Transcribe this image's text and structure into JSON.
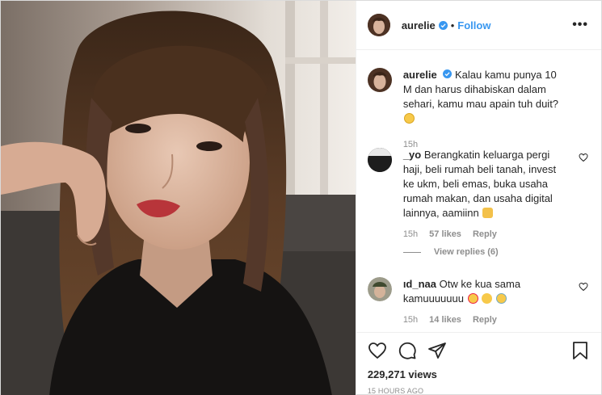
{
  "post": {
    "author": "aurelie",
    "follow_label": "Follow",
    "dot": "•",
    "more_label": "•••",
    "caption_text": "Kalau kamu punya 10 M dan harus dihabiskan dalam sehari, kamu mau apain tuh duit?",
    "caption_time": "15h"
  },
  "comments": [
    {
      "username": "_yo",
      "text": "Berangkatin keluarga pergi haji, beli rumah beli tanah, invest ke ukm, beli emas, buka usaha rumah makan, dan usaha digital lainnya, aamiinn",
      "time": "15h",
      "likes": "57 likes",
      "reply": "Reply",
      "view_replies": "View replies (6)"
    },
    {
      "username": "ıd_naa",
      "text": "Otw ke kua sama kamuuuuuuu",
      "time": "15h",
      "likes": "14 likes",
      "reply": "Reply"
    }
  ],
  "footer": {
    "views": "229,271 views",
    "posted_ago": "15 HOURS AGO"
  },
  "colors": {
    "link": "#3897f0",
    "muted": "#8e8e8e",
    "verified": "#3897f0"
  },
  "icons": [
    "verified-badge-icon",
    "heart-icon",
    "comment-icon",
    "share-icon",
    "bookmark-icon"
  ]
}
